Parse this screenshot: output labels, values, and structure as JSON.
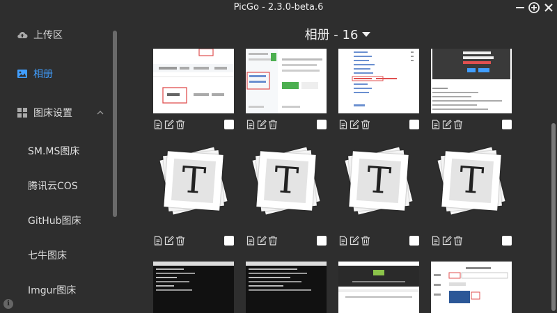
{
  "window": {
    "title": "PicGo - 2.3.0-beta.6"
  },
  "sidebar": {
    "upload_label": "上传区",
    "gallery_label": "相册",
    "settings_label": "图床设置",
    "sub_items": [
      "SM.MS图床",
      "腾讯云COS",
      "GitHub图床",
      "七牛图床",
      "Imgur图床"
    ]
  },
  "gallery": {
    "title": "相册 - 16",
    "t_letter": "T",
    "accent_color": "#409eff"
  }
}
